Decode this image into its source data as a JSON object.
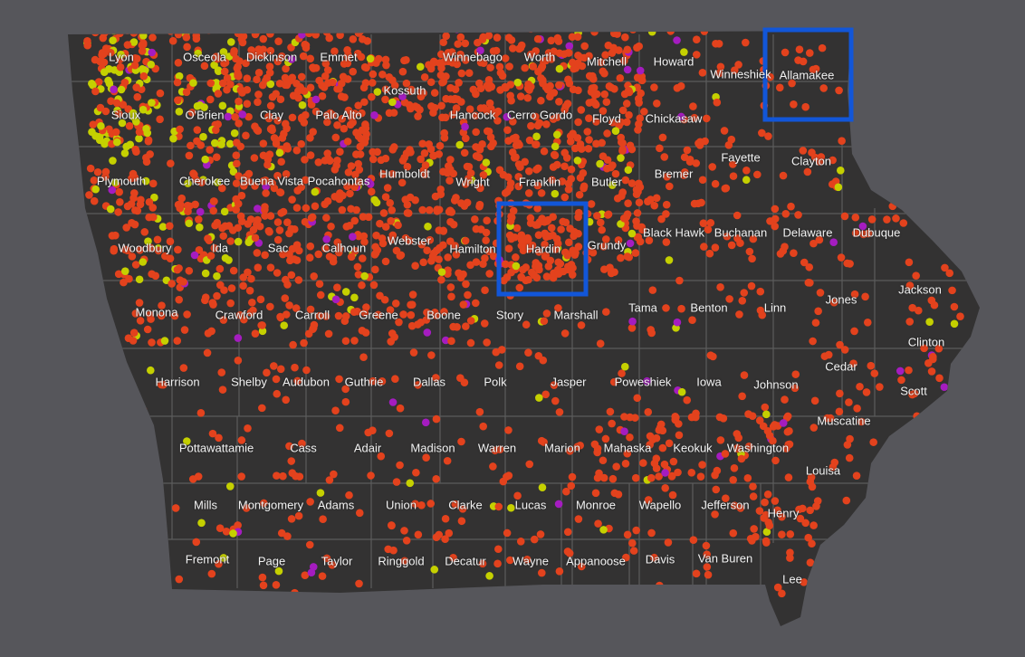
{
  "colors": {
    "background": "#56565b",
    "state_fill": "#333232",
    "county_border": "#5c5c5c",
    "dot_primary": "#e3421d",
    "dot_secondary": "#c5d000",
    "dot_tertiary": "#a51cc0",
    "highlight_box": "#1256d8"
  },
  "highlights": [
    "Allamakee",
    "Hardin"
  ],
  "counties": [
    "Lyon",
    "Osceola",
    "Dickinson",
    "Emmet",
    "Kossuth",
    "Winnebago",
    "Worth",
    "Mitchell",
    "Howard",
    "Winneshiek",
    "Allamakee",
    "Sioux",
    "O'Brien",
    "Clay",
    "Palo Alto",
    "Hancock",
    "Cerro Gordo",
    "Floyd",
    "Chickasaw",
    "Fayette",
    "Clayton",
    "Plymouth",
    "Cherokee",
    "Buena Vista",
    "Pocahontas",
    "Humboldt",
    "Wright",
    "Franklin",
    "Butler",
    "Bremer",
    "Woodbury",
    "Ida",
    "Sac",
    "Calhoun",
    "Webster",
    "Hamilton",
    "Hardin",
    "Grundy",
    "Black Hawk",
    "Buchanan",
    "Delaware",
    "Dubuque",
    "Monona",
    "Crawford",
    "Carroll",
    "Greene",
    "Boone",
    "Story",
    "Marshall",
    "Tama",
    "Benton",
    "Linn",
    "Jones",
    "Jackson",
    "Harrison",
    "Shelby",
    "Audubon",
    "Guthrie",
    "Dallas",
    "Polk",
    "Jasper",
    "Poweshiek",
    "Iowa",
    "Johnson",
    "Cedar",
    "Clinton",
    "Scott",
    "Muscatine",
    "Pottawattamie",
    "Cass",
    "Adair",
    "Madison",
    "Warren",
    "Marion",
    "Mahaska",
    "Keokuk",
    "Washington",
    "Louisa",
    "Mills",
    "Montgomery",
    "Adams",
    "Union",
    "Clarke",
    "Lucas",
    "Monroe",
    "Wapello",
    "Jefferson",
    "Henry",
    "Fremont",
    "Page",
    "Taylor",
    "Ringgold",
    "Decatur",
    "Wayne",
    "Appanoose",
    "Davis",
    "Van Buren",
    "Lee"
  ]
}
